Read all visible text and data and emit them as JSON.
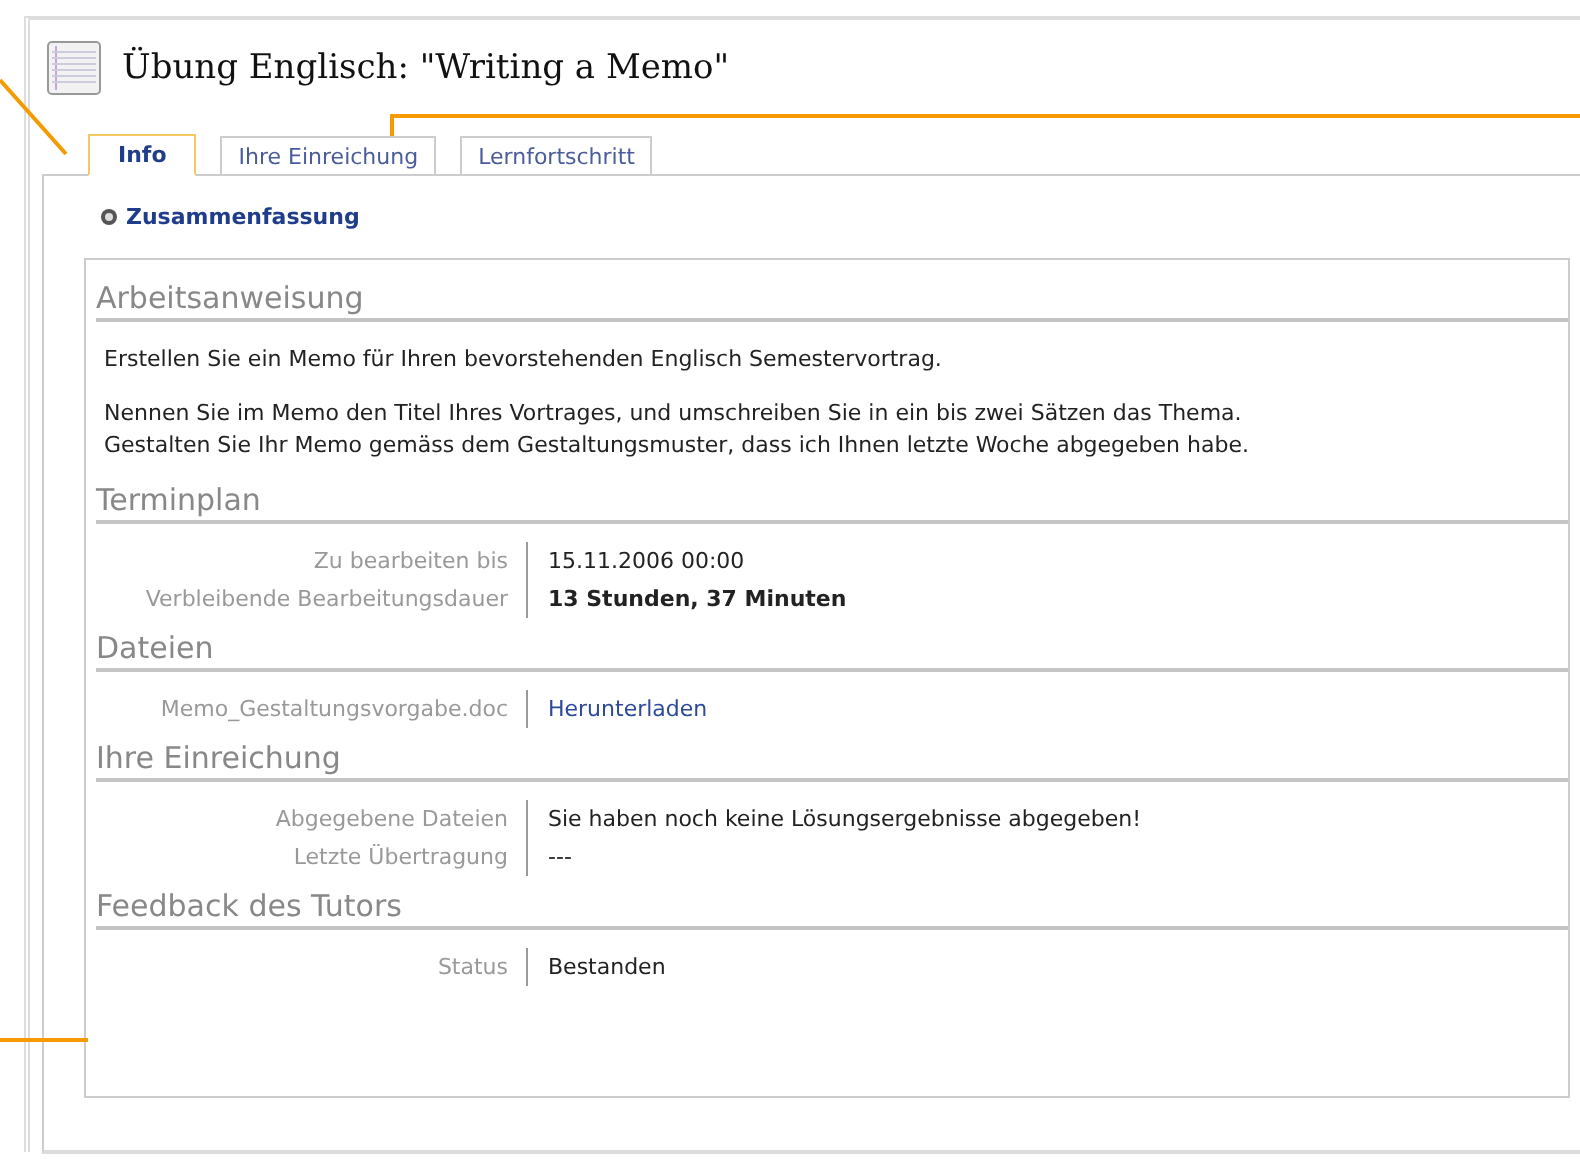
{
  "title": "Übung Englisch: \"Writing a Memo\"",
  "tabs": [
    {
      "label": "Info",
      "selected": true
    },
    {
      "label": "Ihre Einreichung",
      "selected": false
    },
    {
      "label": "Lernfortschritt",
      "selected": false
    }
  ],
  "summary_toggle": {
    "label": "Zusammenfassung",
    "expanded": true
  },
  "sections": [
    {
      "heading": "Arbeitsanweisung",
      "kind": "text",
      "paragraphs": [
        "Erstellen Sie ein Memo für Ihren bevorstehenden Englisch Semestervortrag.",
        "Nennen Sie im Memo den Titel Ihres Vortrages, und umschreiben Sie in ein bis zwei Sätzen das Thema.\nGestalten Sie Ihr Memo gemäss dem Gestaltungsmuster, dass ich Ihnen letzte Woche abgegeben habe."
      ]
    },
    {
      "heading": "Terminplan",
      "kind": "fields",
      "rows": [
        {
          "label": "Zu bearbeiten bis",
          "value": "15.11.2006 00:00",
          "kind": "plain"
        },
        {
          "label": "Verbleibende Bearbeitungsdauer",
          "value": "13 Stunden, 37 Minuten",
          "kind": "bold"
        }
      ]
    },
    {
      "heading": "Dateien",
      "kind": "fields",
      "rows": [
        {
          "label": "Memo_Gestaltungsvorgabe.doc",
          "value": "Herunterladen",
          "kind": "link"
        }
      ]
    },
    {
      "heading": "Ihre Einreichung",
      "kind": "fields",
      "rows": [
        {
          "label": "Abgegebene Dateien",
          "value": "Sie haben noch keine Lösungsergebnisse abgegeben!",
          "kind": "plain"
        },
        {
          "label": "Letzte Übertragung",
          "value": "---",
          "kind": "plain"
        }
      ]
    },
    {
      "heading": "Feedback des Tutors",
      "kind": "fields",
      "rows": [
        {
          "label": "Status",
          "value": "Bestanden",
          "kind": "plain"
        }
      ]
    }
  ]
}
